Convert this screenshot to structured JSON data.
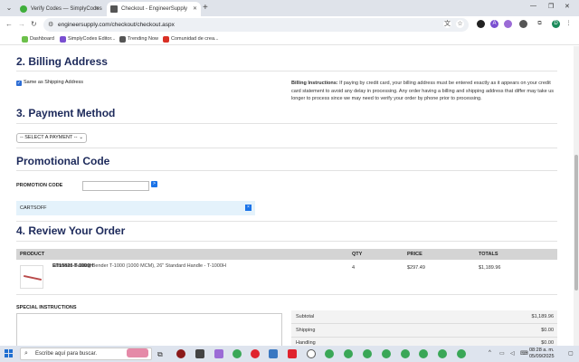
{
  "browser": {
    "tabs": [
      {
        "title": "Verify Codes — SimplyCodes",
        "active": false,
        "favicon_color": "#3fae3b"
      },
      {
        "title": "Checkout - EngineerSupply",
        "active": true,
        "favicon_color": "#555555"
      }
    ],
    "new_tab_glyph": "+",
    "url": "engineersupply.com/checkout/checkout.aspx",
    "bookmarks": [
      {
        "label": "Dashboard",
        "color": "#6cc04a"
      },
      {
        "label": "SimplyCodes Editor...",
        "color": "#7a4fd1"
      },
      {
        "label": "Trending Now",
        "color": "#555555"
      },
      {
        "label": "Comunidad de crea...",
        "color": "#d93025"
      }
    ]
  },
  "billing": {
    "heading": "2. Billing Address",
    "same_as_shipping_label": "Same as Shipping Address",
    "same_as_shipping_checked": true,
    "note_title": "Billing Instructions:",
    "note_body": " If paying by credit card, your billing address must be entered exactly as it appears on your credit card statement to avoid any delay in processing. Any order having a billing and shipping address that differ may take us longer to process since we may need to verify your order by phone prior to processing."
  },
  "payment": {
    "heading": "3. Payment Method",
    "select_value": "-- SELECT A PAYMENT --"
  },
  "promo": {
    "heading": "Promotional Code",
    "label": "PROMOTION CODE",
    "input_value": "",
    "apply_glyph": ">",
    "applied_code": "CARTSOFF",
    "remove_glyph": "×"
  },
  "review": {
    "heading": "4. Review Your Order",
    "columns": {
      "product": "PRODUCT",
      "qty": "QTY",
      "price": "PRICE",
      "totals": "TOTALS"
    },
    "items": [
      {
        "part_number": "ET15826-T-1000H",
        "description": "Jameson Bulldog Bender T-1000 (1000 MCM), 26\" Standard Handle - T-1000H",
        "qty": "4",
        "price": "$297.49",
        "total": "$1,189.96"
      }
    ]
  },
  "special_instructions": {
    "label": "SPECIAL INSTRUCTIONS",
    "value": ""
  },
  "summary": [
    {
      "label": "Subtotal",
      "value": "$1,189.96"
    },
    {
      "label": "Shipping",
      "value": "$0.00"
    },
    {
      "label": "Handling",
      "value": "$0.00"
    }
  ],
  "taskbar": {
    "search_placeholder": "Escribe aquí para buscar.",
    "time": "08:28 a. m.",
    "date": "05/09/2025"
  }
}
